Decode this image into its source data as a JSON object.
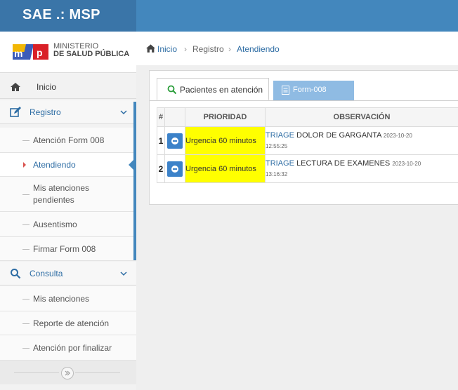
{
  "app": {
    "title": "SAE .: MSP"
  },
  "logo": {
    "line1": "MINISTERIO",
    "line2": "DE SALUD PÚBLICA"
  },
  "sidebar": {
    "home": {
      "label": "Inicio",
      "icon": "home-icon"
    },
    "registro": {
      "label": "Registro",
      "icon": "edit-icon",
      "items": [
        {
          "label": "Atención Form 008"
        },
        {
          "label": "Atendiendo",
          "active": true
        },
        {
          "label": "Mis atenciones pendientes"
        },
        {
          "label": "Ausentismo"
        },
        {
          "label": "Firmar Form 008"
        }
      ]
    },
    "consulta": {
      "label": "Consulta",
      "icon": "search-icon",
      "items": [
        {
          "label": "Mis atenciones"
        },
        {
          "label": "Reporte de atención"
        },
        {
          "label": "Atención por finalizar"
        }
      ]
    }
  },
  "breadcrumb": {
    "home": "Inicio",
    "sep": "›",
    "level2": "Registro",
    "level3": "Atendiendo"
  },
  "tabs": [
    {
      "label": "Pacientes en atención",
      "icon": "search-icon",
      "active": true
    },
    {
      "label": "Form-008",
      "icon": "document-icon",
      "active": false
    }
  ],
  "table": {
    "headers": [
      "#",
      "",
      "PRIORIDAD",
      "OBSERVACIÓN"
    ],
    "rows": [
      {
        "num": "1",
        "prioridad": "Urgencia 60 minutos",
        "obs_kw": "TRIAGE",
        "obs_text": " DOLOR DE GARGANTA ",
        "date": "2023-10-20",
        "time": "12:55:25"
      },
      {
        "num": "2",
        "prioridad": "Urgencia 60 minutos",
        "obs_kw": "TRIAGE",
        "obs_text": " LECTURA DE EXAMENES ",
        "date": "2023-10-20",
        "time": "13:16:32"
      }
    ]
  },
  "colors": {
    "header_bg": "#4387bd",
    "brand_bg": "#3a75a8",
    "accent": "#2e6da4",
    "priority_highlight": "#ffff00",
    "tab_inactive_bg": "#8fbbe3"
  }
}
